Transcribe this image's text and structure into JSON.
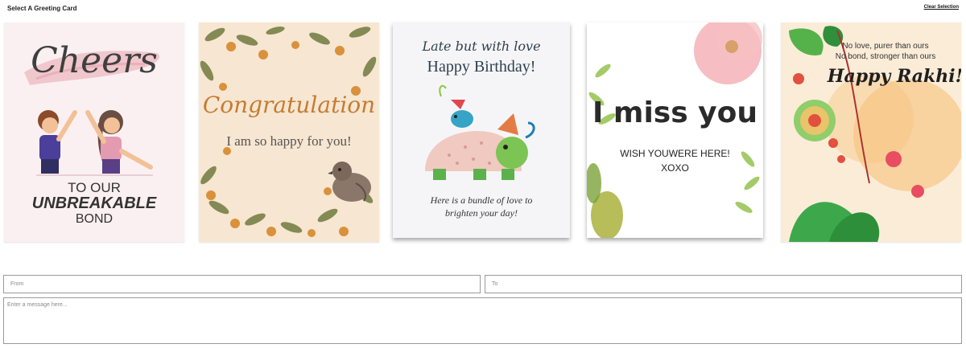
{
  "header": {
    "title": "Select A Greeting Card",
    "clear_label": "Clear Selection"
  },
  "cards": [
    {
      "script": "Cheers",
      "line1": "TO OUR",
      "line2": "UNBREAKABLE",
      "line3": "BOND"
    },
    {
      "script": "Congratulation",
      "line1": "I am so happy for you!"
    },
    {
      "script": "Late but with love",
      "line1": "Happy Birthday!",
      "line2": "Here is a bundle of love to",
      "line3": "brighten your day!"
    },
    {
      "script": "I miss you",
      "line1": "WISH YOUWERE HERE!",
      "line2": "XOXO"
    },
    {
      "line1": "No love, purer than ours",
      "line2": "No bond, stronger than ours",
      "script": "Happy Rakhi!"
    }
  ],
  "form": {
    "from_placeholder": "From",
    "to_placeholder": "To",
    "message_placeholder": "Enter a message here..."
  }
}
